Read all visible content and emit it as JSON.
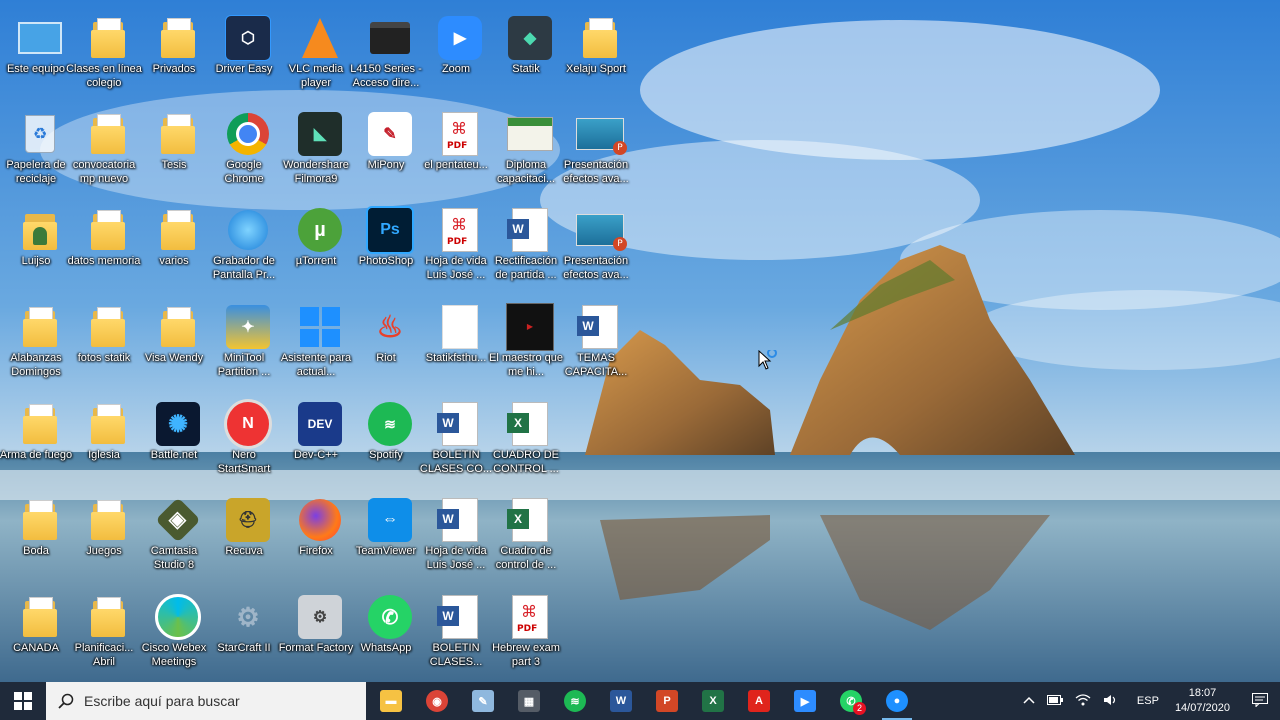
{
  "desktop": {
    "icons": [
      {
        "label": "Este equipo",
        "icon": "this-pc-icon"
      },
      {
        "label": "Clases en línea colegio",
        "icon": "folder-icon"
      },
      {
        "label": "Privados",
        "icon": "folder-icon"
      },
      {
        "label": "Driver Easy",
        "icon": "driver-easy-icon"
      },
      {
        "label": "VLC media player",
        "icon": "vlc-icon"
      },
      {
        "label": "L4150 Series - Acceso dire...",
        "icon": "printer-icon"
      },
      {
        "label": "Zoom",
        "icon": "zoom-icon"
      },
      {
        "label": "Statik",
        "icon": "statik-icon"
      },
      {
        "label": "Xelaju Sport",
        "icon": "folder-icon"
      },
      {
        "label": "Papelera de reciclaje",
        "icon": "recycle-bin-icon"
      },
      {
        "label": "convocatoria mp nuevo",
        "icon": "folder-icon"
      },
      {
        "label": "Tesis",
        "icon": "folder-icon"
      },
      {
        "label": "Google Chrome",
        "icon": "chrome-icon"
      },
      {
        "label": "Wondershare Filmora9",
        "icon": "filmora-icon"
      },
      {
        "label": "MiPony",
        "icon": "mipony-icon"
      },
      {
        "label": "el pentateu...",
        "icon": "pdf-icon"
      },
      {
        "label": "Diploma capacitaci...",
        "icon": "image-file-icon"
      },
      {
        "label": "Presentación efectos ava...",
        "icon": "powerpoint-file-icon"
      },
      {
        "label": "Luijso",
        "icon": "user-folder-icon"
      },
      {
        "label": "datos memoria",
        "icon": "folder-icon"
      },
      {
        "label": "varios",
        "icon": "folder-icon"
      },
      {
        "label": "Grabador de Pantalla Pr...",
        "icon": "screen-recorder-icon"
      },
      {
        "label": "µTorrent",
        "icon": "utorrent-icon"
      },
      {
        "label": "PhotoShop",
        "icon": "photoshop-icon"
      },
      {
        "label": "Hoja de vida Luis José ...",
        "icon": "pdf-icon"
      },
      {
        "label": "Rectificación de partida ...",
        "icon": "word-file-icon"
      },
      {
        "label": "Presentación efectos ava...",
        "icon": "powerpoint-file-icon"
      },
      {
        "label": "Alabanzas Domingos",
        "icon": "folder-icon"
      },
      {
        "label": "fotos statik",
        "icon": "folder-icon"
      },
      {
        "label": "Visa Wendy",
        "icon": "folder-icon"
      },
      {
        "label": "MiniTool Partition ...",
        "icon": "minitool-icon"
      },
      {
        "label": "Asistente para actual...",
        "icon": "windows-update-icon"
      },
      {
        "label": "Riot",
        "icon": "riot-icon"
      },
      {
        "label": "Statikfsthu...",
        "icon": "blank-file-icon"
      },
      {
        "label": "El maestro que me hi...",
        "icon": "video-file-icon"
      },
      {
        "label": "TEMAS CAPACITA...",
        "icon": "word-file-icon"
      },
      {
        "label": "Arma de fuego",
        "icon": "folder-icon"
      },
      {
        "label": "Iglesia",
        "icon": "folder-icon"
      },
      {
        "label": "Battle.net",
        "icon": "battlenet-icon"
      },
      {
        "label": "Nero StartSmart",
        "icon": "nero-icon"
      },
      {
        "label": "Dev-C++",
        "icon": "devcpp-icon"
      },
      {
        "label": "Spotify",
        "icon": "spotify-icon"
      },
      {
        "label": "BOLETIN CLASES CO...",
        "icon": "word-file-icon"
      },
      {
        "label": "CUADRO DE CONTROL ...",
        "icon": "excel-file-icon"
      },
      {
        "label": "Boda",
        "icon": "folder-icon"
      },
      {
        "label": "Juegos",
        "icon": "folder-icon"
      },
      {
        "label": "Camtasia Studio 8",
        "icon": "camtasia-icon"
      },
      {
        "label": "Recuva",
        "icon": "recuva-icon"
      },
      {
        "label": "Firefox",
        "icon": "firefox-icon"
      },
      {
        "label": "TeamViewer",
        "icon": "teamviewer-icon"
      },
      {
        "label": "Hoja de vida Luis José ...",
        "icon": "word-file-icon"
      },
      {
        "label": "Cuadro de control de ...",
        "icon": "excel-file-icon"
      },
      {
        "label": "CANADA",
        "icon": "folder-icon"
      },
      {
        "label": "Planificaci... Abril",
        "icon": "folder-icon"
      },
      {
        "label": "Cisco Webex Meetings",
        "icon": "webex-icon"
      },
      {
        "label": "StarCraft II",
        "icon": "starcraft-icon"
      },
      {
        "label": "Format Factory",
        "icon": "format-factory-icon"
      },
      {
        "label": "WhatsApp",
        "icon": "whatsapp-icon"
      },
      {
        "label": "BOLETIN CLASES...",
        "icon": "word-file-icon"
      },
      {
        "label": "Hebrew exam part 3",
        "icon": "pdf-icon"
      }
    ]
  },
  "taskbar": {
    "search_placeholder": "Escribe aquí para buscar",
    "apps": [
      {
        "name": "file-explorer",
        "icon": "file-explorer-icon",
        "color": "#f6c243"
      },
      {
        "name": "chrome",
        "icon": "chrome-icon",
        "color": "#db4437"
      },
      {
        "name": "notes",
        "icon": "notes-icon",
        "color": "#8fb8de"
      },
      {
        "name": "calculator",
        "icon": "calculator-icon",
        "color": "#555c66"
      },
      {
        "name": "spotify",
        "icon": "spotify-icon",
        "color": "#1db954"
      },
      {
        "name": "word",
        "icon": "word-icon",
        "color": "#2b579a"
      },
      {
        "name": "powerpoint",
        "icon": "powerpoint-icon",
        "color": "#d24726"
      },
      {
        "name": "excel",
        "icon": "excel-icon",
        "color": "#217346"
      },
      {
        "name": "acrobat",
        "icon": "acrobat-icon",
        "color": "#e0241c"
      },
      {
        "name": "zoom",
        "icon": "zoom-icon",
        "color": "#2d8cff"
      },
      {
        "name": "whatsapp",
        "icon": "whatsapp-icon",
        "color": "#25d366",
        "badge": "2"
      },
      {
        "name": "screen-recorder",
        "icon": "screen-recorder-icon",
        "color": "#1e90ff"
      }
    ],
    "tray": {
      "language": "ESP",
      "time": "18:07",
      "date": "14/07/2020"
    }
  }
}
